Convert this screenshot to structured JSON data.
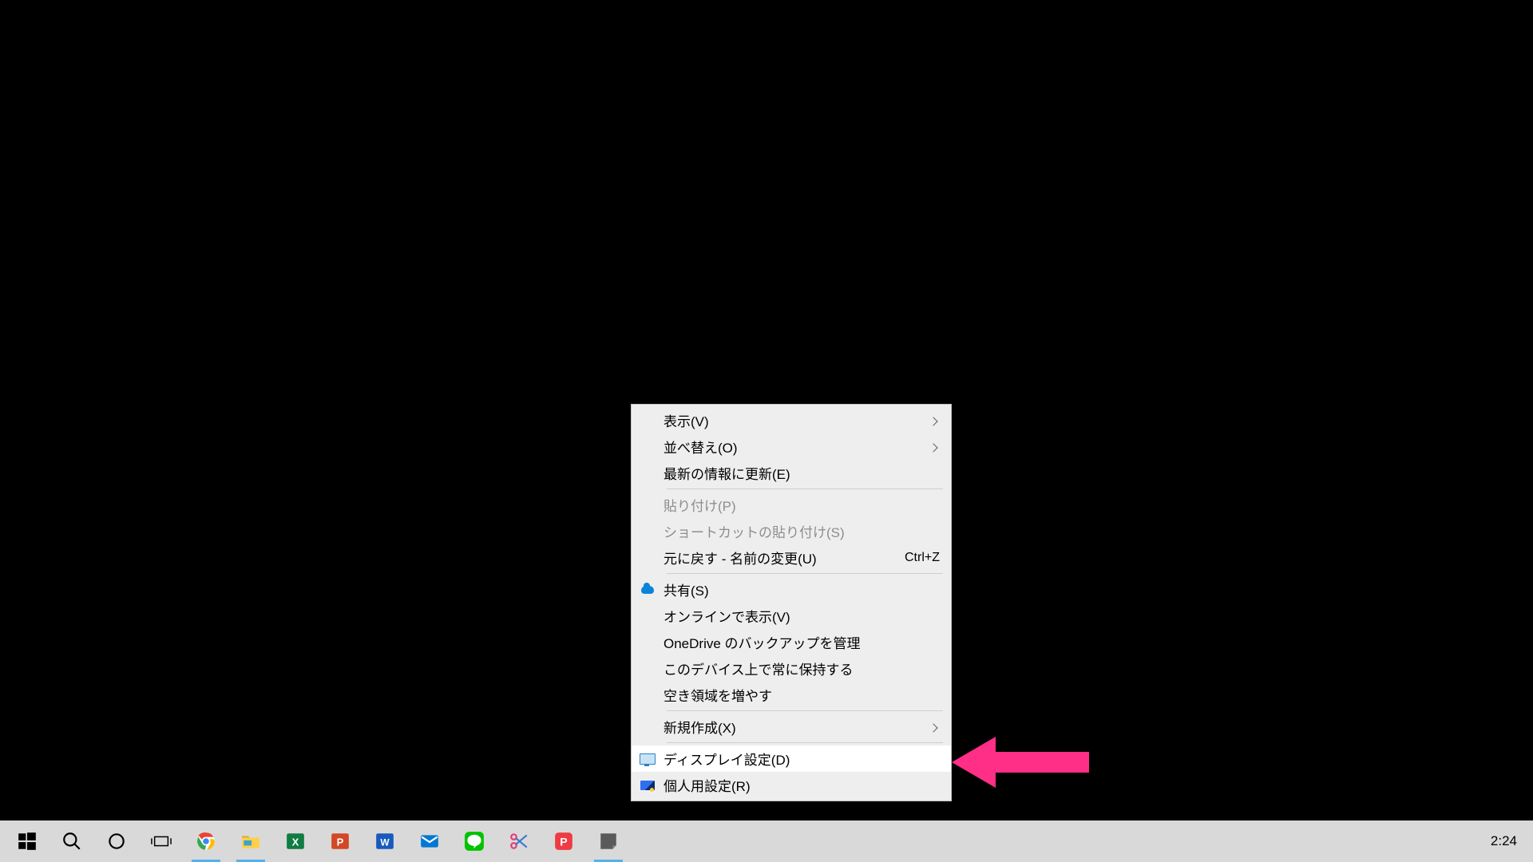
{
  "context_menu": {
    "items": [
      {
        "label": "表示(V)",
        "submenu": true
      },
      {
        "label": "並べ替え(O)",
        "submenu": true
      },
      {
        "label": "最新の情報に更新(E)"
      },
      {
        "sep": true
      },
      {
        "label": "貼り付け(P)",
        "disabled": true
      },
      {
        "label": "ショートカットの貼り付け(S)",
        "disabled": true
      },
      {
        "label": "元に戻す - 名前の変更(U)",
        "accel": "Ctrl+Z"
      },
      {
        "sep": true
      },
      {
        "label": "共有(S)",
        "icon": "cloud"
      },
      {
        "label": "オンラインで表示(V)"
      },
      {
        "label": "OneDrive のバックアップを管理"
      },
      {
        "label": "このデバイス上で常に保持する"
      },
      {
        "label": "空き領域を増やす"
      },
      {
        "sep": true
      },
      {
        "label": "新規作成(X)",
        "submenu": true
      },
      {
        "sep": true
      },
      {
        "label": "ディスプレイ設定(D)",
        "icon": "display",
        "hover": true
      },
      {
        "label": "個人用設定(R)",
        "icon": "personalize"
      }
    ]
  },
  "taskbar": {
    "buttons": [
      {
        "name": "start",
        "running": false
      },
      {
        "name": "search",
        "running": false
      },
      {
        "name": "cortana",
        "running": false
      },
      {
        "name": "task-view",
        "running": false
      },
      {
        "name": "chrome",
        "running": true
      },
      {
        "name": "file-explorer",
        "running": true
      },
      {
        "name": "excel",
        "running": false
      },
      {
        "name": "powerpoint",
        "running": false
      },
      {
        "name": "word",
        "running": false
      },
      {
        "name": "mail",
        "running": false
      },
      {
        "name": "line",
        "running": false
      },
      {
        "name": "snipping-tool",
        "running": false
      },
      {
        "name": "phonto",
        "running": false
      },
      {
        "name": "sticky-notes",
        "running": true
      }
    ],
    "clock": "2:24"
  },
  "annotation": {
    "type": "arrow",
    "color": "#ff2d86"
  }
}
